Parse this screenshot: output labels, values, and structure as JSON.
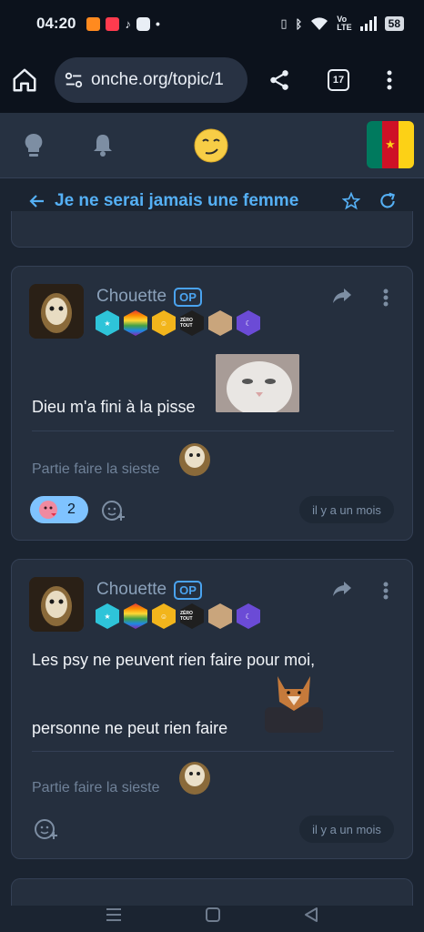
{
  "statusbar": {
    "time": "04:20",
    "battery": "58"
  },
  "browser": {
    "url": "onche.org/topic/1",
    "tab_count": "17"
  },
  "topic": {
    "title": "Je ne serai jamais une femme"
  },
  "posts": [
    {
      "author": "Chouette",
      "op_label": "OP",
      "message": "Dieu m'a fini à la pisse",
      "signature": "Partie faire la sieste",
      "reaction_count": "2",
      "timestamp": "il y a un mois"
    },
    {
      "author": "Chouette",
      "op_label": "OP",
      "message_line1": "Les psy ne peuvent rien faire pour moi,",
      "message_line2": "personne ne peut rien faire",
      "signature": "Partie faire la sieste",
      "timestamp": "il y a un mois"
    }
  ],
  "badge_labels": {
    "zero_tout": "ZÉRO TOUT"
  },
  "colors": {
    "accent": "#4aa3ef",
    "title_blue": "#55b0f5",
    "reaction": "#7fc3ff",
    "card": "#252f3e",
    "background": "#1b2431"
  },
  "icons": [
    "home-icon",
    "site-settings-icon",
    "share-icon",
    "more-vert-icon",
    "lightbulb-icon",
    "bell-icon",
    "smiley-logo-icon",
    "cameroon-flag-icon",
    "back-arrow-icon",
    "star-icon",
    "refresh-icon",
    "reply-icon",
    "add-reaction-icon",
    "recent-apps-icon",
    "home-nav-icon",
    "back-nav-icon"
  ]
}
